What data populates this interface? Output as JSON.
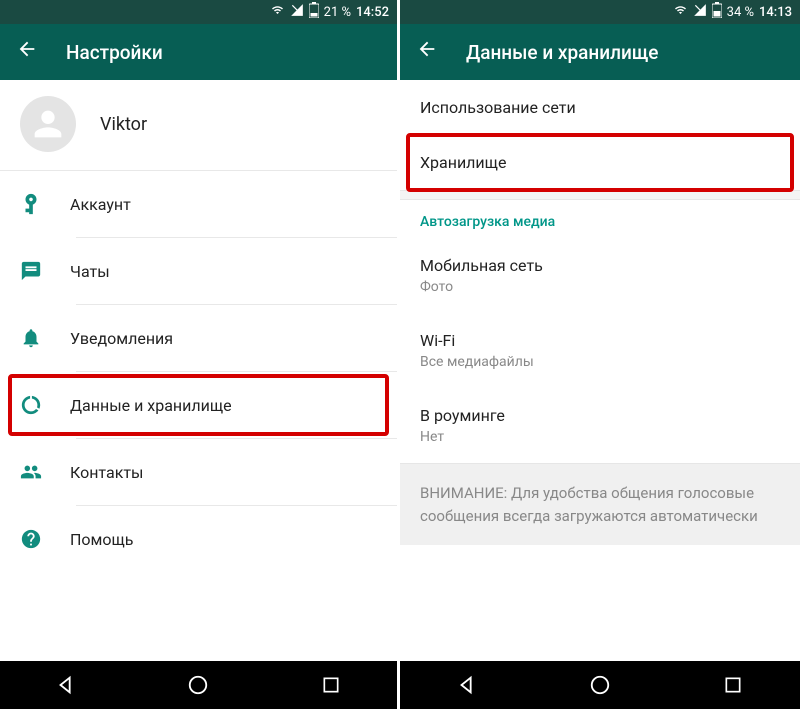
{
  "left": {
    "status": {
      "battery_pct": "21 %",
      "time": "14:52"
    },
    "appbar": {
      "title": "Настройки"
    },
    "profile": {
      "name": "Viktor"
    },
    "menu": {
      "account": "Аккаунт",
      "chats": "Чаты",
      "notifications": "Уведомления",
      "data_storage": "Данные и хранилище",
      "contacts": "Контакты",
      "help": "Помощь"
    }
  },
  "right": {
    "status": {
      "battery_pct": "34 %",
      "time": "14:13"
    },
    "appbar": {
      "title": "Данные и хранилище"
    },
    "items": {
      "network_usage": "Использование сети",
      "storage": "Хранилище",
      "section_autoload": "Автозагрузка медиа",
      "mobile_title": "Мобильная сеть",
      "mobile_sub": "Фото",
      "wifi_title": "Wi-Fi",
      "wifi_sub": "Все медиафайлы",
      "roaming_title": "В роуминге",
      "roaming_sub": "Нет",
      "warning": "ВНИМАНИЕ: Для удобства общения голосовые сообщения всегда загружаются автоматически"
    }
  }
}
